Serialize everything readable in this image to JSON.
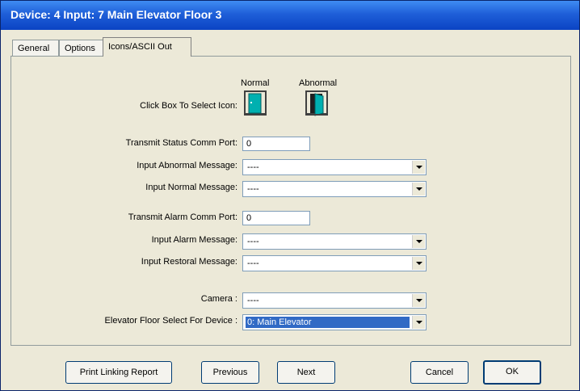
{
  "window": {
    "title": "Device: 4  Input: 7  Main Elevator Floor 3"
  },
  "tabs": [
    {
      "label": "General"
    },
    {
      "label": "Options"
    },
    {
      "label": "Icons/ASCII Out"
    }
  ],
  "icons": {
    "normal_header": "Normal",
    "abnormal_header": "Abnormal",
    "select_label": "Click Box To Select Icon:",
    "normal_icon": "door-closed-icon",
    "abnormal_icon": "door-open-icon",
    "colors": {
      "door": "#00b0b0",
      "frame": "#404040"
    }
  },
  "status_port": {
    "label": "Transmit Status Comm Port:",
    "value": "0"
  },
  "abnormal_msg": {
    "label": "Input Abnormal Message:",
    "value": "----"
  },
  "normal_msg": {
    "label": "Input Normal Message:",
    "value": "----"
  },
  "alarm_port": {
    "label": "Transmit Alarm Comm Port:",
    "value": "0"
  },
  "alarm_msg": {
    "label": "Input Alarm Message:",
    "value": "----"
  },
  "restoral_msg": {
    "label": "Input Restoral Message:",
    "value": "----"
  },
  "camera": {
    "label": "Camera :",
    "value": "----"
  },
  "elevator": {
    "label": "Elevator Floor Select For Device :",
    "value": "0: Main Elevator"
  },
  "buttons": {
    "print": "Print Linking Report",
    "previous": "Previous",
    "next": "Next",
    "cancel": "Cancel",
    "ok": "OK"
  }
}
